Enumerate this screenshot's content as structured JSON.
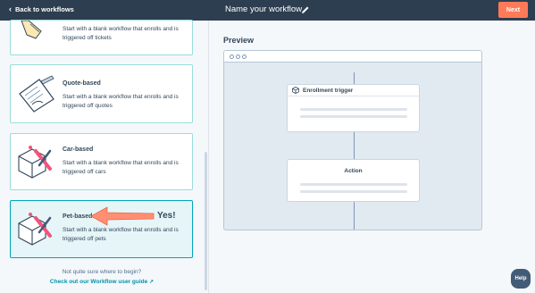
{
  "topbar": {
    "back_label": "Back to workflows",
    "title": "Name your workflow",
    "next_label": "Next"
  },
  "cards": [
    {
      "title": "",
      "desc": "Start with a blank workflow that enrolls and is triggered off tickets"
    },
    {
      "title": "Quote-based",
      "desc": "Start with a blank workflow that enrolls and is triggered off quotes"
    },
    {
      "title": "Car-based",
      "desc": "Start with a blank workflow that enrolls and is triggered off cars"
    },
    {
      "title": "Pet-based",
      "desc": "Start with a blank workflow that enrolls and is triggered off pets",
      "selected": true
    }
  ],
  "annotation": {
    "text": "Yes!"
  },
  "help_section": {
    "question": "Not quite sure where to begin?",
    "link": "Check out our Workflow user guide"
  },
  "preview": {
    "label": "Preview",
    "trigger_node": "Enrollment trigger",
    "action_node": "Action"
  },
  "help_button": "Help",
  "colors": {
    "topbar": "#2d3e50",
    "accent_orange": "#ff7a59",
    "teal_border": "#00a4bd",
    "link": "#0091ae"
  }
}
